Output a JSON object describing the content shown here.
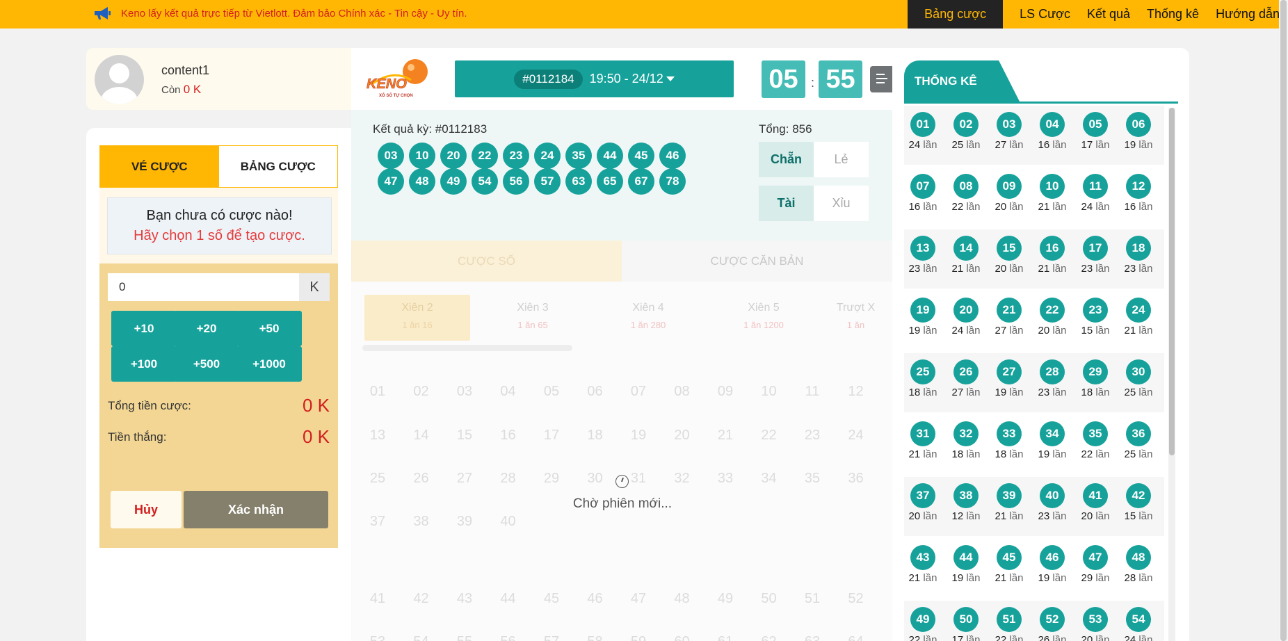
{
  "announcement": "Keno lấy kết quả trực tiếp từ Vietlott. Đảm bảo Chính xác - Tin cậy - Uy tín.",
  "nav": [
    "Bảng cược",
    "LS Cược",
    "Kết quả",
    "Thống kê",
    "Hướng dẫn"
  ],
  "user": {
    "name": "content1",
    "balance_label": "Còn",
    "balance": "0 K"
  },
  "bet": {
    "tabs": [
      "VÉ CƯỢC",
      "BẢNG CƯỢC"
    ],
    "empty_title": "Bạn chưa có cược nào!",
    "empty_hint": "Hãy chọn 1 số để tạo cược.",
    "amount_value": "0",
    "amount_unit": "K",
    "quick": [
      "+10",
      "+20",
      "+50",
      "+100",
      "+500",
      "+1000"
    ],
    "total_label": "Tổng tiền cược:",
    "total_value": "0 K",
    "win_label": "Tiền thắng:",
    "win_value": "0 K",
    "cancel": "Hủy",
    "confirm": "Xác nhận"
  },
  "logo": {
    "text": "KENO",
    "subtitle": "XỔ SỐ TỰ CHỌN"
  },
  "draw": {
    "code": "#0112184",
    "time": "19:50 - 24/12"
  },
  "timer": {
    "minutes": "05",
    "seconds": "55",
    "sep": ":"
  },
  "result": {
    "title": "Kết quả kỳ: #0112183",
    "total": "Tổng: 856",
    "balls": [
      "03",
      "10",
      "20",
      "22",
      "23",
      "24",
      "35",
      "44",
      "45",
      "46",
      "47",
      "48",
      "49",
      "54",
      "56",
      "57",
      "63",
      "65",
      "67",
      "78"
    ],
    "tags": [
      "Chẵn",
      "Lẻ",
      "Tài",
      "Xỉu"
    ]
  },
  "mode_tabs": [
    "CƯỢC SỐ",
    "CƯỢC CĂN BẢN"
  ],
  "subtabs": [
    {
      "name": "Xiên 2",
      "rate": "1 ăn 16"
    },
    {
      "name": "Xiên 3",
      "rate": "1 ăn 65"
    },
    {
      "name": "Xiên 4",
      "rate": "1 ăn 280"
    },
    {
      "name": "Xiên 5",
      "rate": "1 ăn 1200"
    },
    {
      "name": "Trượt X",
      "rate": "1 ăn"
    }
  ],
  "wait_text": "Chờ phiên mới...",
  "stats": {
    "title": "THỐNG KÊ",
    "unit": "lần",
    "items": [
      [
        "01",
        24
      ],
      [
        "02",
        25
      ],
      [
        "03",
        27
      ],
      [
        "04",
        16
      ],
      [
        "05",
        17
      ],
      [
        "06",
        19
      ],
      [
        "07",
        16
      ],
      [
        "08",
        22
      ],
      [
        "09",
        20
      ],
      [
        "10",
        21
      ],
      [
        "11",
        24
      ],
      [
        "12",
        16
      ],
      [
        "13",
        23
      ],
      [
        "14",
        21
      ],
      [
        "15",
        20
      ],
      [
        "16",
        21
      ],
      [
        "17",
        23
      ],
      [
        "18",
        23
      ],
      [
        "19",
        19
      ],
      [
        "20",
        24
      ],
      [
        "21",
        27
      ],
      [
        "22",
        20
      ],
      [
        "23",
        15
      ],
      [
        "24",
        21
      ],
      [
        "25",
        18
      ],
      [
        "26",
        27
      ],
      [
        "27",
        19
      ],
      [
        "28",
        23
      ],
      [
        "29",
        18
      ],
      [
        "30",
        25
      ],
      [
        "31",
        21
      ],
      [
        "32",
        18
      ],
      [
        "33",
        18
      ],
      [
        "34",
        19
      ],
      [
        "35",
        22
      ],
      [
        "36",
        25
      ],
      [
        "37",
        20
      ],
      [
        "38",
        12
      ],
      [
        "39",
        21
      ],
      [
        "40",
        23
      ],
      [
        "41",
        20
      ],
      [
        "42",
        15
      ],
      [
        "43",
        21
      ],
      [
        "44",
        19
      ],
      [
        "45",
        21
      ],
      [
        "46",
        19
      ],
      [
        "47",
        29
      ],
      [
        "48",
        28
      ],
      [
        "49",
        22
      ],
      [
        "50",
        17
      ],
      [
        "51",
        22
      ],
      [
        "52",
        26
      ],
      [
        "53",
        20
      ],
      [
        "54",
        24
      ]
    ]
  },
  "colors": {
    "accent": "#16a29b",
    "brand_yellow": "#ffb703",
    "danger": "#d21f1f"
  }
}
